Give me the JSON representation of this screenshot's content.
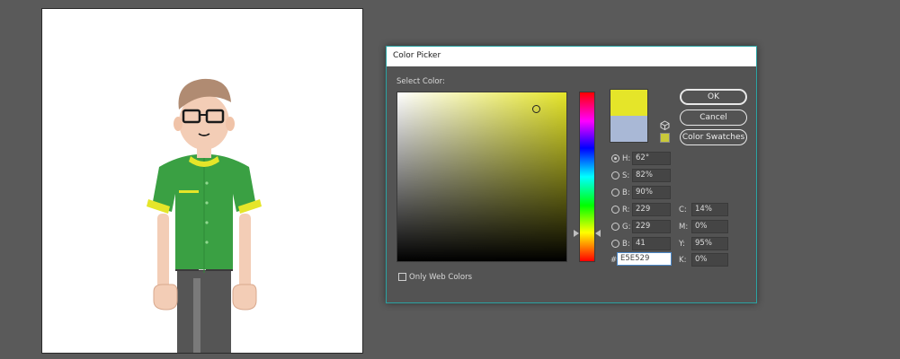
{
  "dialog": {
    "title": "Color Picker",
    "select_label": "Select Color:",
    "only_web_label": "Only Web Colors",
    "buttons": {
      "ok": "OK",
      "cancel": "Cancel",
      "swatches": "Color Swatches"
    },
    "hsb": [
      {
        "label": "H:",
        "value": "62°"
      },
      {
        "label": "S:",
        "value": "82%"
      },
      {
        "label": "B:",
        "value": "90%"
      }
    ],
    "rgb": [
      {
        "label": "R:",
        "value": "229"
      },
      {
        "label": "G:",
        "value": "229"
      },
      {
        "label": "B:",
        "value": "41"
      }
    ],
    "cmyk": [
      {
        "label": "C:",
        "value": "14%"
      },
      {
        "label": "M:",
        "value": "0%"
      },
      {
        "label": "Y:",
        "value": "95%"
      },
      {
        "label": "K:",
        "value": "0%"
      }
    ],
    "hex_symbol": "#",
    "hex_value": "E5E529",
    "colors": {
      "new": "#e5e529",
      "old": "#a9b8d6"
    }
  }
}
